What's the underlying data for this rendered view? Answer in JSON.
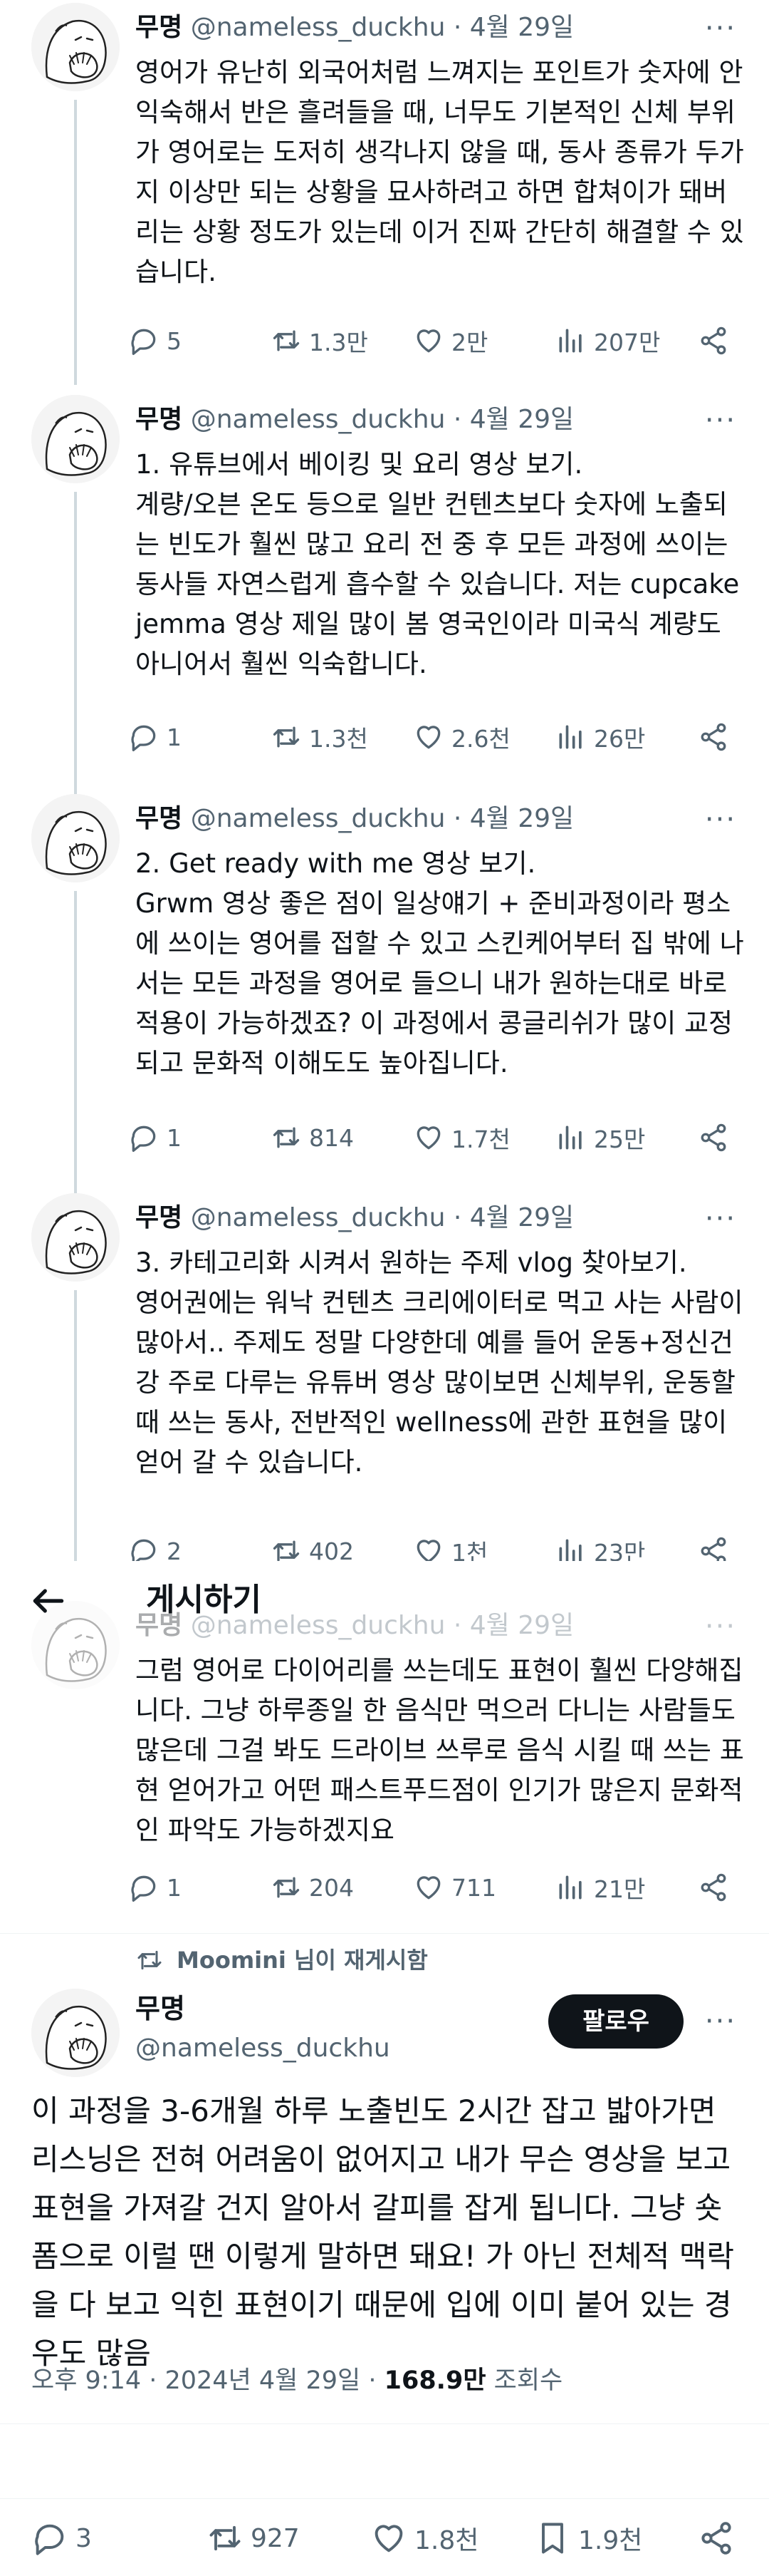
{
  "author": {
    "name": "무명",
    "handle": "@nameless_duckhu",
    "time": "4월 29일",
    "sep": "·"
  },
  "tweets": [
    {
      "text": "영어가 유난히 외국어처럼 느껴지는 포인트가 숫자에 안 익숙해서 반은 흘려들을 때, 너무도 기본적인 신체 부위가 영어로는 도저히 생각나지 않을 때, 동사 종류가 두가지 이상만 되는 상황을 묘사하려고 하면 합쳐이가 돼버리는 상황 정도가 있는데 이거 진짜 간단히 해결할 수 있습니다.",
      "replies": "5",
      "reposts": "1.3만",
      "likes": "2만",
      "views": "207만"
    },
    {
      "text": "1. 유튜브에서 베이킹 및 요리 영상 보기.\n계량/오븐 온도 등으로 일반 컨텐츠보다 숫자에 노출되는 빈도가 훨씬 많고 요리 전 중 후 모든 과정에 쓰이는 동사들 자연스럽게 흡수할 수 있습니다. 저는 cupcake jemma 영상 제일 많이 봄 영국인이라 미국식 계량도 아니어서 훨씬 익숙합니다.",
      "replies": "1",
      "reposts": "1.3천",
      "likes": "2.6천",
      "views": "26만"
    },
    {
      "text": "2. Get ready with me 영상 보기.\nGrwm 영상 좋은 점이 일상얘기 + 준비과정이라 평소에 쓰이는 영어를 접할 수 있고 스킨케어부터 집 밖에 나서는 모든 과정을 영어로 들으니 내가 원하는대로 바로 적용이 가능하겠죠? 이 과정에서 콩글리쉬가 많이 교정되고 문화적 이해도도 높아집니다.",
      "replies": "1",
      "reposts": "814",
      "likes": "1.7천",
      "views": "25만"
    },
    {
      "text": "3. 카테고리화 시켜서 원하는 주제 vlog 찾아보기.\n영어권에는 워낙 컨텐츠 크리에이터로 먹고 사는 사람이 많아서.. 주제도 정말 다양한데 예를 들어 운동+정신건강 주로 다루는 유튜버 영상 많이보면 신체부위, 운동할 때 쓰는 동사, 전반적인 wellness에 관한 표현을 많이 얻어 갈 수 있습니다.",
      "replies": "2",
      "reposts": "402",
      "likes": "1천",
      "views": "23만"
    },
    {
      "text": "그럼 영어로 다이어리를 쓰는데도 표현이 훨씬 다양해집니다. 그냥 하루종일 한 음식만 먹으러 다니는 사람들도 많은데 그걸 봐도 드라이브 쓰루로 음식 시킬 때 쓰는 표현 얻어가고 어떤 패스트푸드점이 인기가 많은지 문화적인 파악도 가능하겠지요",
      "replies": "1",
      "reposts": "204",
      "likes": "711",
      "views": "21만"
    }
  ],
  "overlay": {
    "title": "게시하기"
  },
  "retweeted_by": "Moomini 님이 재게시함",
  "main": {
    "follow_label": "팔로우",
    "text": "이 과정을 3-6개월 하루 노출빈도 2시간 잡고 밟아가면 리스닝은 전혀 어려움이 없어지고 내가 무슨 영상을 보고 표현을 가져갈 건지 알아서 갈피를 잡게 됩니다. 그냥 숏폼으로 이럴 땐 이렇게 말하면 돼요! 가 아닌 전체적 맥락을 다 보고 익힌 표현이기 때문에 입에 이미 붙어 있는 경우도 많음",
    "time": "오후 9:14 · 2024년 4월 29일 · ",
    "views_count": "168.9만",
    "views_label": " 조회수",
    "replies": "3",
    "reposts": "927",
    "likes": "1.8천",
    "bookmarks": "1.9천"
  },
  "icons": [
    "reply-icon",
    "repost-icon",
    "like-icon",
    "views-icon",
    "share-icon",
    "bookmark-icon",
    "back-arrow-icon",
    "more-icon"
  ],
  "colors": {
    "text": "#0f1419",
    "muted": "#536471",
    "button": "#0f1419",
    "thread_line": "#cfd9de"
  }
}
